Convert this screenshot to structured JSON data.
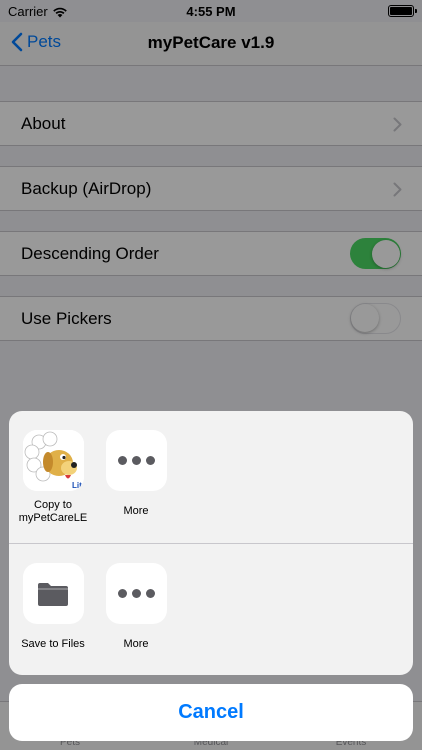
{
  "status": {
    "carrier": "Carrier",
    "time": "4:55 PM"
  },
  "nav": {
    "back_label": "Pets",
    "title": "myPetCare v1.9"
  },
  "settings": {
    "rows": [
      {
        "label": "About"
      },
      {
        "label": "Backup (AirDrop)"
      },
      {
        "label": "Descending Order",
        "toggle_on": true
      },
      {
        "label": "Use Pickers",
        "toggle_on": false
      }
    ]
  },
  "tabs": [
    {
      "label": "Pets"
    },
    {
      "label": "Medical"
    },
    {
      "label": "Events"
    }
  ],
  "share_sheet": {
    "apps": [
      {
        "label": "Copy to myPetCareLE",
        "icon": "mypetcare-le-app-icon",
        "badge": "Lite"
      },
      {
        "label": "More",
        "icon": "more-dots-icon"
      }
    ],
    "actions": [
      {
        "label": "Save to Files",
        "icon": "folder-icon"
      },
      {
        "label": "More",
        "icon": "more-dots-icon"
      }
    ],
    "cancel_label": "Cancel"
  },
  "colors": {
    "accent": "#007aff",
    "toggle_on": "#4cd964",
    "dim": "rgba(0,0,0,0.4)"
  }
}
